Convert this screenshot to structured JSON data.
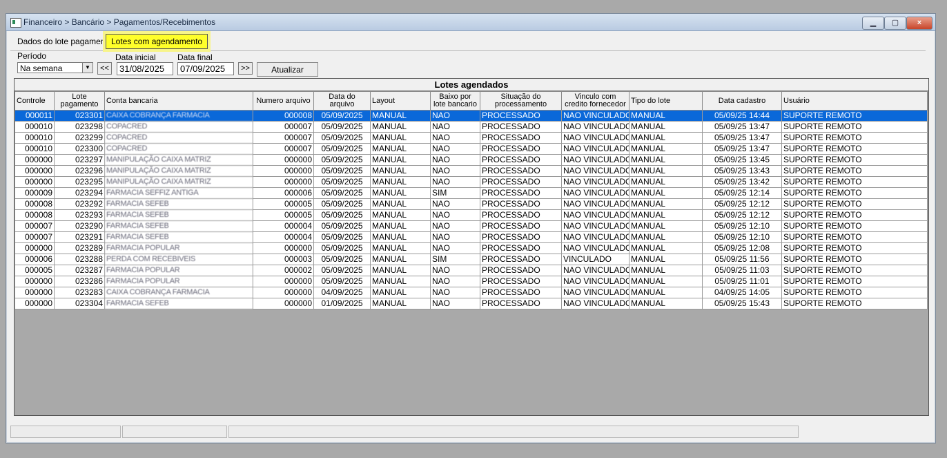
{
  "window": {
    "title": "Financeiro > Bancário > Pagamentos/Recebimentos",
    "close_icon": "×"
  },
  "tabs": [
    "Dados do lote pagamento",
    "Lotes com agendamento"
  ],
  "filter": {
    "periodo_label": "Período",
    "periodo_value": "Na semana",
    "prev_label": "<<",
    "next_label": ">>",
    "data_inicial_label": "Data inicial",
    "data_inicial": "31/08/2025",
    "data_final_label": "Data final",
    "data_final": "07/09/2025",
    "atualizar_label": "Atualizar"
  },
  "grid": {
    "caption": "Lotes agendados",
    "columns": [
      "Controle",
      "Lote pagamento",
      "Conta bancaria",
      "Numero arquivo",
      "Data do arquivo",
      "Layout",
      "Baixo por lote bancario",
      "Situação do processamento",
      "Vinculo com credito fornecedor",
      "Tipo do lote",
      "Data cadastro",
      "Usuário"
    ],
    "rows": [
      [
        "000011",
        "023301",
        "CAIXA COBRANÇA FARMACIA",
        "000008",
        "05/09/2025",
        "MANUAL",
        "NAO",
        "PROCESSADO",
        "NAO VINCULADO",
        "MANUAL",
        "05/09/25 14:44",
        "SUPORTE REMOTO"
      ],
      [
        "000010",
        "023298",
        "COPACRED",
        "000007",
        "05/09/2025",
        "MANUAL",
        "NAO",
        "PROCESSADO",
        "NAO VINCULADO",
        "MANUAL",
        "05/09/25 13:47",
        "SUPORTE REMOTO"
      ],
      [
        "000010",
        "023299",
        "COPACRED",
        "000007",
        "05/09/2025",
        "MANUAL",
        "NAO",
        "PROCESSADO",
        "NAO VINCULADO",
        "MANUAL",
        "05/09/25 13:47",
        "SUPORTE REMOTO"
      ],
      [
        "000010",
        "023300",
        "COPACRED",
        "000007",
        "05/09/2025",
        "MANUAL",
        "NAO",
        "PROCESSADO",
        "NAO VINCULADO",
        "MANUAL",
        "05/09/25 13:47",
        "SUPORTE REMOTO"
      ],
      [
        "000000",
        "023297",
        "MANIPULAÇÃO CAIXA MATRIZ",
        "000000",
        "05/09/2025",
        "MANUAL",
        "NAO",
        "PROCESSADO",
        "NAO VINCULADO",
        "MANUAL",
        "05/09/25 13:45",
        "SUPORTE REMOTO"
      ],
      [
        "000000",
        "023296",
        "MANIPULAÇÃO CAIXA MATRIZ",
        "000000",
        "05/09/2025",
        "MANUAL",
        "NAO",
        "PROCESSADO",
        "NAO VINCULADO",
        "MANUAL",
        "05/09/25 13:43",
        "SUPORTE REMOTO"
      ],
      [
        "000000",
        "023295",
        "MANIPULAÇÃO CAIXA MATRIZ",
        "000000",
        "05/09/2025",
        "MANUAL",
        "NAO",
        "PROCESSADO",
        "NAO VINCULADO",
        "MANUAL",
        "05/09/25 13:42",
        "SUPORTE REMOTO"
      ],
      [
        "000009",
        "023294",
        "FARMACIA SEFFIZ ANTIGA",
        "000006",
        "05/09/2025",
        "MANUAL",
        "SIM",
        "PROCESSADO",
        "NAO VINCULADO",
        "MANUAL",
        "05/09/25 12:14",
        "SUPORTE REMOTO"
      ],
      [
        "000008",
        "023292",
        "FARMACIA SEFEB",
        "000005",
        "05/09/2025",
        "MANUAL",
        "NAO",
        "PROCESSADO",
        "NAO VINCULADO",
        "MANUAL",
        "05/09/25 12:12",
        "SUPORTE REMOTO"
      ],
      [
        "000008",
        "023293",
        "FARMACIA SEFEB",
        "000005",
        "05/09/2025",
        "MANUAL",
        "NAO",
        "PROCESSADO",
        "NAO VINCULADO",
        "MANUAL",
        "05/09/25 12:12",
        "SUPORTE REMOTO"
      ],
      [
        "000007",
        "023290",
        "FARMACIA SEFEB",
        "000004",
        "05/09/2025",
        "MANUAL",
        "NAO",
        "PROCESSADO",
        "NAO VINCULADO",
        "MANUAL",
        "05/09/25 12:10",
        "SUPORTE REMOTO"
      ],
      [
        "000007",
        "023291",
        "FARMACIA SEFEB",
        "000004",
        "05/09/2025",
        "MANUAL",
        "NAO",
        "PROCESSADO",
        "NAO VINCULADO",
        "MANUAL",
        "05/09/25 12:10",
        "SUPORTE REMOTO"
      ],
      [
        "000000",
        "023289",
        "FARMACIA POPULAR",
        "000000",
        "05/09/2025",
        "MANUAL",
        "NAO",
        "PROCESSADO",
        "NAO VINCULADO",
        "MANUAL",
        "05/09/25 12:08",
        "SUPORTE REMOTO"
      ],
      [
        "000006",
        "023288",
        "PERDA COM RECEBIVEIS",
        "000003",
        "05/09/2025",
        "MANUAL",
        "SIM",
        "PROCESSADO",
        "VINCULADO",
        "MANUAL",
        "05/09/25 11:56",
        "SUPORTE REMOTO"
      ],
      [
        "000005",
        "023287",
        "FARMACIA POPULAR",
        "000002",
        "05/09/2025",
        "MANUAL",
        "NAO",
        "PROCESSADO",
        "NAO VINCULADO",
        "MANUAL",
        "05/09/25 11:03",
        "SUPORTE REMOTO"
      ],
      [
        "000000",
        "023286",
        "FARMACIA POPULAR",
        "000000",
        "05/09/2025",
        "MANUAL",
        "NAO",
        "PROCESSADO",
        "NAO VINCULADO",
        "MANUAL",
        "05/09/25 11:01",
        "SUPORTE REMOTO"
      ],
      [
        "000000",
        "023283",
        "CAIXA COBRANÇA FARMACIA",
        "000000",
        "04/09/2025",
        "MANUAL",
        "NAO",
        "PROCESSADO",
        "NAO VINCULADO",
        "MANUAL",
        "04/09/25 14:05",
        "SUPORTE REMOTO"
      ],
      [
        "000000",
        "023304",
        "FARMACIA SEFEB",
        "000000",
        "01/09/2025",
        "MANUAL",
        "NAO",
        "PROCESSADO",
        "NAO VINCULADO",
        "MANUAL",
        "05/09/25 15:43",
        "SUPORTE REMOTO"
      ]
    ]
  }
}
